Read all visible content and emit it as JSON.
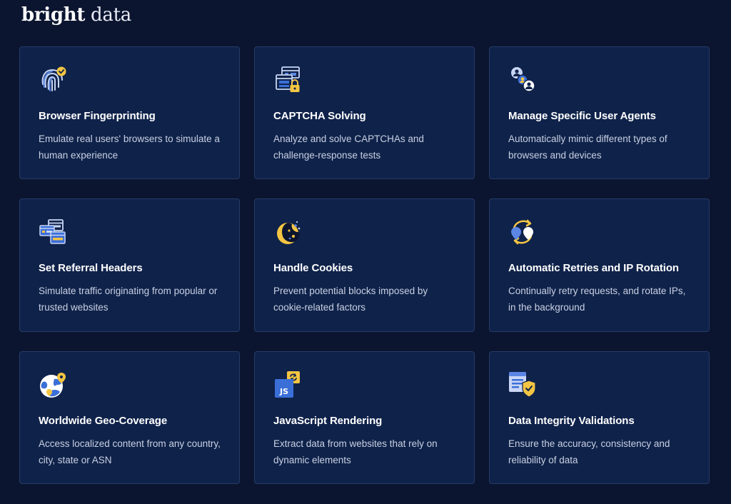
{
  "brand": {
    "name_bold": "bright",
    "name_light": "data"
  },
  "colors": {
    "background": "#0b1530",
    "card": "#0f224a",
    "card_border": "#263b66",
    "accent_blue": "#3b6fd8",
    "accent_yellow": "#f4c542"
  },
  "cards": [
    {
      "icon": "fingerprint-icon",
      "title": "Browser Fingerprinting",
      "description": "Emulate real users' browsers to simulate a human experience"
    },
    {
      "icon": "captcha-lock-icon",
      "title": "CAPTCHA Solving",
      "description": "Analyze and solve CAPTCHAs and challenge-response tests"
    },
    {
      "icon": "user-agents-icon",
      "title": "Manage Specific User Agents",
      "description": "Automatically mimic different types of browsers and devices"
    },
    {
      "icon": "referral-headers-icon",
      "title": "Set Referral Headers",
      "description": "Simulate traffic originating from popular or trusted websites"
    },
    {
      "icon": "cookie-icon",
      "title": "Handle Cookies",
      "description": "Prevent potential blocks imposed by cookie-related factors"
    },
    {
      "icon": "ip-rotation-icon",
      "title": "Automatic Retries and IP Rotation",
      "description": "Continually retry requests, and rotate IPs, in the background"
    },
    {
      "icon": "globe-pin-icon",
      "title": "Worldwide Geo-Coverage",
      "description": "Access localized content from any country, city, state or ASN"
    },
    {
      "icon": "javascript-icon",
      "title": "JavaScript Rendering",
      "description": "Extract data from websites that rely on dynamic elements"
    },
    {
      "icon": "data-shield-icon",
      "title": "Data Integrity Validations",
      "description": "Ensure the accuracy, consistency and reliability of data"
    }
  ]
}
